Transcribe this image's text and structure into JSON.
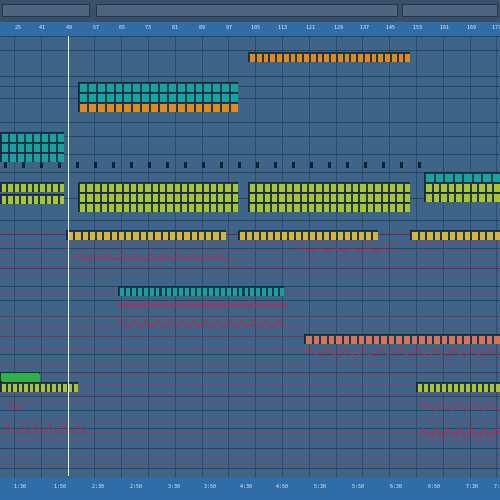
{
  "ruler": {
    "bars": [
      "25",
      "41",
      "49",
      "57",
      "65",
      "73",
      "81",
      "89",
      "97",
      "105",
      "113",
      "121",
      "129",
      "137",
      "145",
      "153",
      "161",
      "169",
      "177"
    ]
  },
  "timeline": {
    "labels": [
      "1:30",
      "1:50",
      "2:30",
      "2:50",
      "3:30",
      "3:50",
      "4:30",
      "4:50",
      "5:30",
      "5:50",
      "6:30",
      "6:50",
      "7:30",
      "7:50"
    ]
  },
  "colors": {
    "orange_clip": "#e08a18",
    "teal_clip": "#16a3a0",
    "yellow_green_clip": "#a9c430",
    "automation_line": "#c0244e",
    "salmon_clip": "#d4755a",
    "green_clip": "#2fb04a"
  }
}
